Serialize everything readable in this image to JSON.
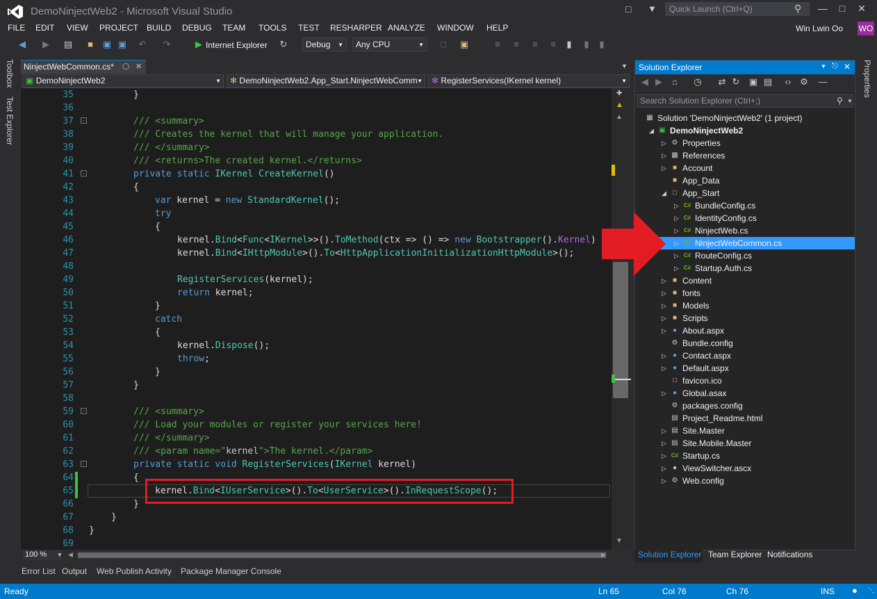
{
  "window": {
    "title": "DemoNinjectWeb2 - Microsoft Visual Studio",
    "quick_launch_placeholder": "Quick Launch (Ctrl+Q)",
    "user_name": "Win Lwin Oo",
    "user_initials": "WO"
  },
  "menu": [
    "FILE",
    "EDIT",
    "VIEW",
    "PROJECT",
    "BUILD",
    "DEBUG",
    "TEAM",
    "TOOLS",
    "TEST",
    "RESHARPER",
    "ANALYZE",
    "WINDOW",
    "HELP"
  ],
  "toolbar": {
    "run_target": "Internet Explorer",
    "configuration": "Debug",
    "platform": "Any CPU"
  },
  "left_rail": {
    "toolbox": "Toolbox",
    "test_explorer": "Test Explorer"
  },
  "editor": {
    "tab_label": "NinjectWebCommon.cs*",
    "nav_project": "DemoNinjectWeb2",
    "nav_class": "DemoNinjectWeb2.App_Start.NinjectWebComm",
    "nav_member": "RegisterServices(IKernel kernel)",
    "zoom": "100 %",
    "line_numbers": [
      "35",
      "36",
      "37",
      "38",
      "39",
      "40",
      "41",
      "42",
      "43",
      "44",
      "45",
      "46",
      "47",
      "48",
      "49",
      "50",
      "51",
      "52",
      "53",
      "54",
      "55",
      "56",
      "57",
      "58",
      "59",
      "60",
      "61",
      "62",
      "63",
      "64",
      "65",
      "66",
      "67",
      "68",
      "69"
    ]
  },
  "bottom_tabs": [
    "Error List",
    "Output",
    "Web Publish Activity",
    "Package Manager Console"
  ],
  "status": {
    "state": "Ready",
    "line": "Ln 65",
    "col": "Col 76",
    "ch": "Ch 76",
    "mode": "INS"
  },
  "solution_explorer": {
    "title": "Solution Explorer",
    "search_placeholder": "Search Solution Explorer (Ctrl+;)",
    "nodes": [
      {
        "label": "Solution 'DemoNinjectWeb2' (1 project)",
        "icon": "solution-icon"
      },
      {
        "label": "DemoNinjectWeb2",
        "icon": "web-project-icon"
      },
      {
        "label": "Properties",
        "icon": "wrench-icon"
      },
      {
        "label": "References",
        "icon": "references-icon"
      },
      {
        "label": "Account",
        "icon": "folder-icon"
      },
      {
        "label": "App_Data",
        "icon": "folder-icon"
      },
      {
        "label": "App_Start",
        "icon": "folder-open-icon"
      },
      {
        "label": "BundleConfig.cs",
        "icon": "csharp-file-icon"
      },
      {
        "label": "IdentityConfig.cs",
        "icon": "csharp-file-icon"
      },
      {
        "label": "NinjectWeb.cs",
        "icon": "csharp-file-icon"
      },
      {
        "label": "NinjectWebCommon.cs",
        "icon": "csharp-file-icon"
      },
      {
        "label": "RouteConfig.cs",
        "icon": "csharp-file-icon"
      },
      {
        "label": "Startup.Auth.cs",
        "icon": "csharp-file-icon"
      },
      {
        "label": "Content",
        "icon": "folder-icon"
      },
      {
        "label": "fonts",
        "icon": "folder-icon"
      },
      {
        "label": "Models",
        "icon": "folder-icon"
      },
      {
        "label": "Scripts",
        "icon": "folder-icon"
      },
      {
        "label": "About.aspx",
        "icon": "aspx-file-icon"
      },
      {
        "label": "Bundle.config",
        "icon": "config-file-icon"
      },
      {
        "label": "Contact.aspx",
        "icon": "aspx-file-icon"
      },
      {
        "label": "Default.aspx",
        "icon": "aspx-file-icon"
      },
      {
        "label": "favicon.ico",
        "icon": "ico-file-icon"
      },
      {
        "label": "Global.asax",
        "icon": "asax-file-icon"
      },
      {
        "label": "packages.config",
        "icon": "config-file-icon"
      },
      {
        "label": "Project_Readme.html",
        "icon": "html-file-icon"
      },
      {
        "label": "Site.Master",
        "icon": "master-file-icon"
      },
      {
        "label": "Site.Mobile.Master",
        "icon": "master-file-icon"
      },
      {
        "label": "Startup.cs",
        "icon": "csharp-file-icon"
      },
      {
        "label": "ViewSwitcher.ascx",
        "icon": "ascx-file-icon"
      },
      {
        "label": "Web.config",
        "icon": "config-file-icon"
      }
    ],
    "tabs": [
      "Solution Explorer",
      "Team Explorer",
      "Notifications"
    ]
  },
  "right_rail": {
    "properties": "Properties"
  },
  "colors": {
    "accent": "#007acc",
    "selection": "#3399ff",
    "annotation_red": "#e31b23"
  }
}
